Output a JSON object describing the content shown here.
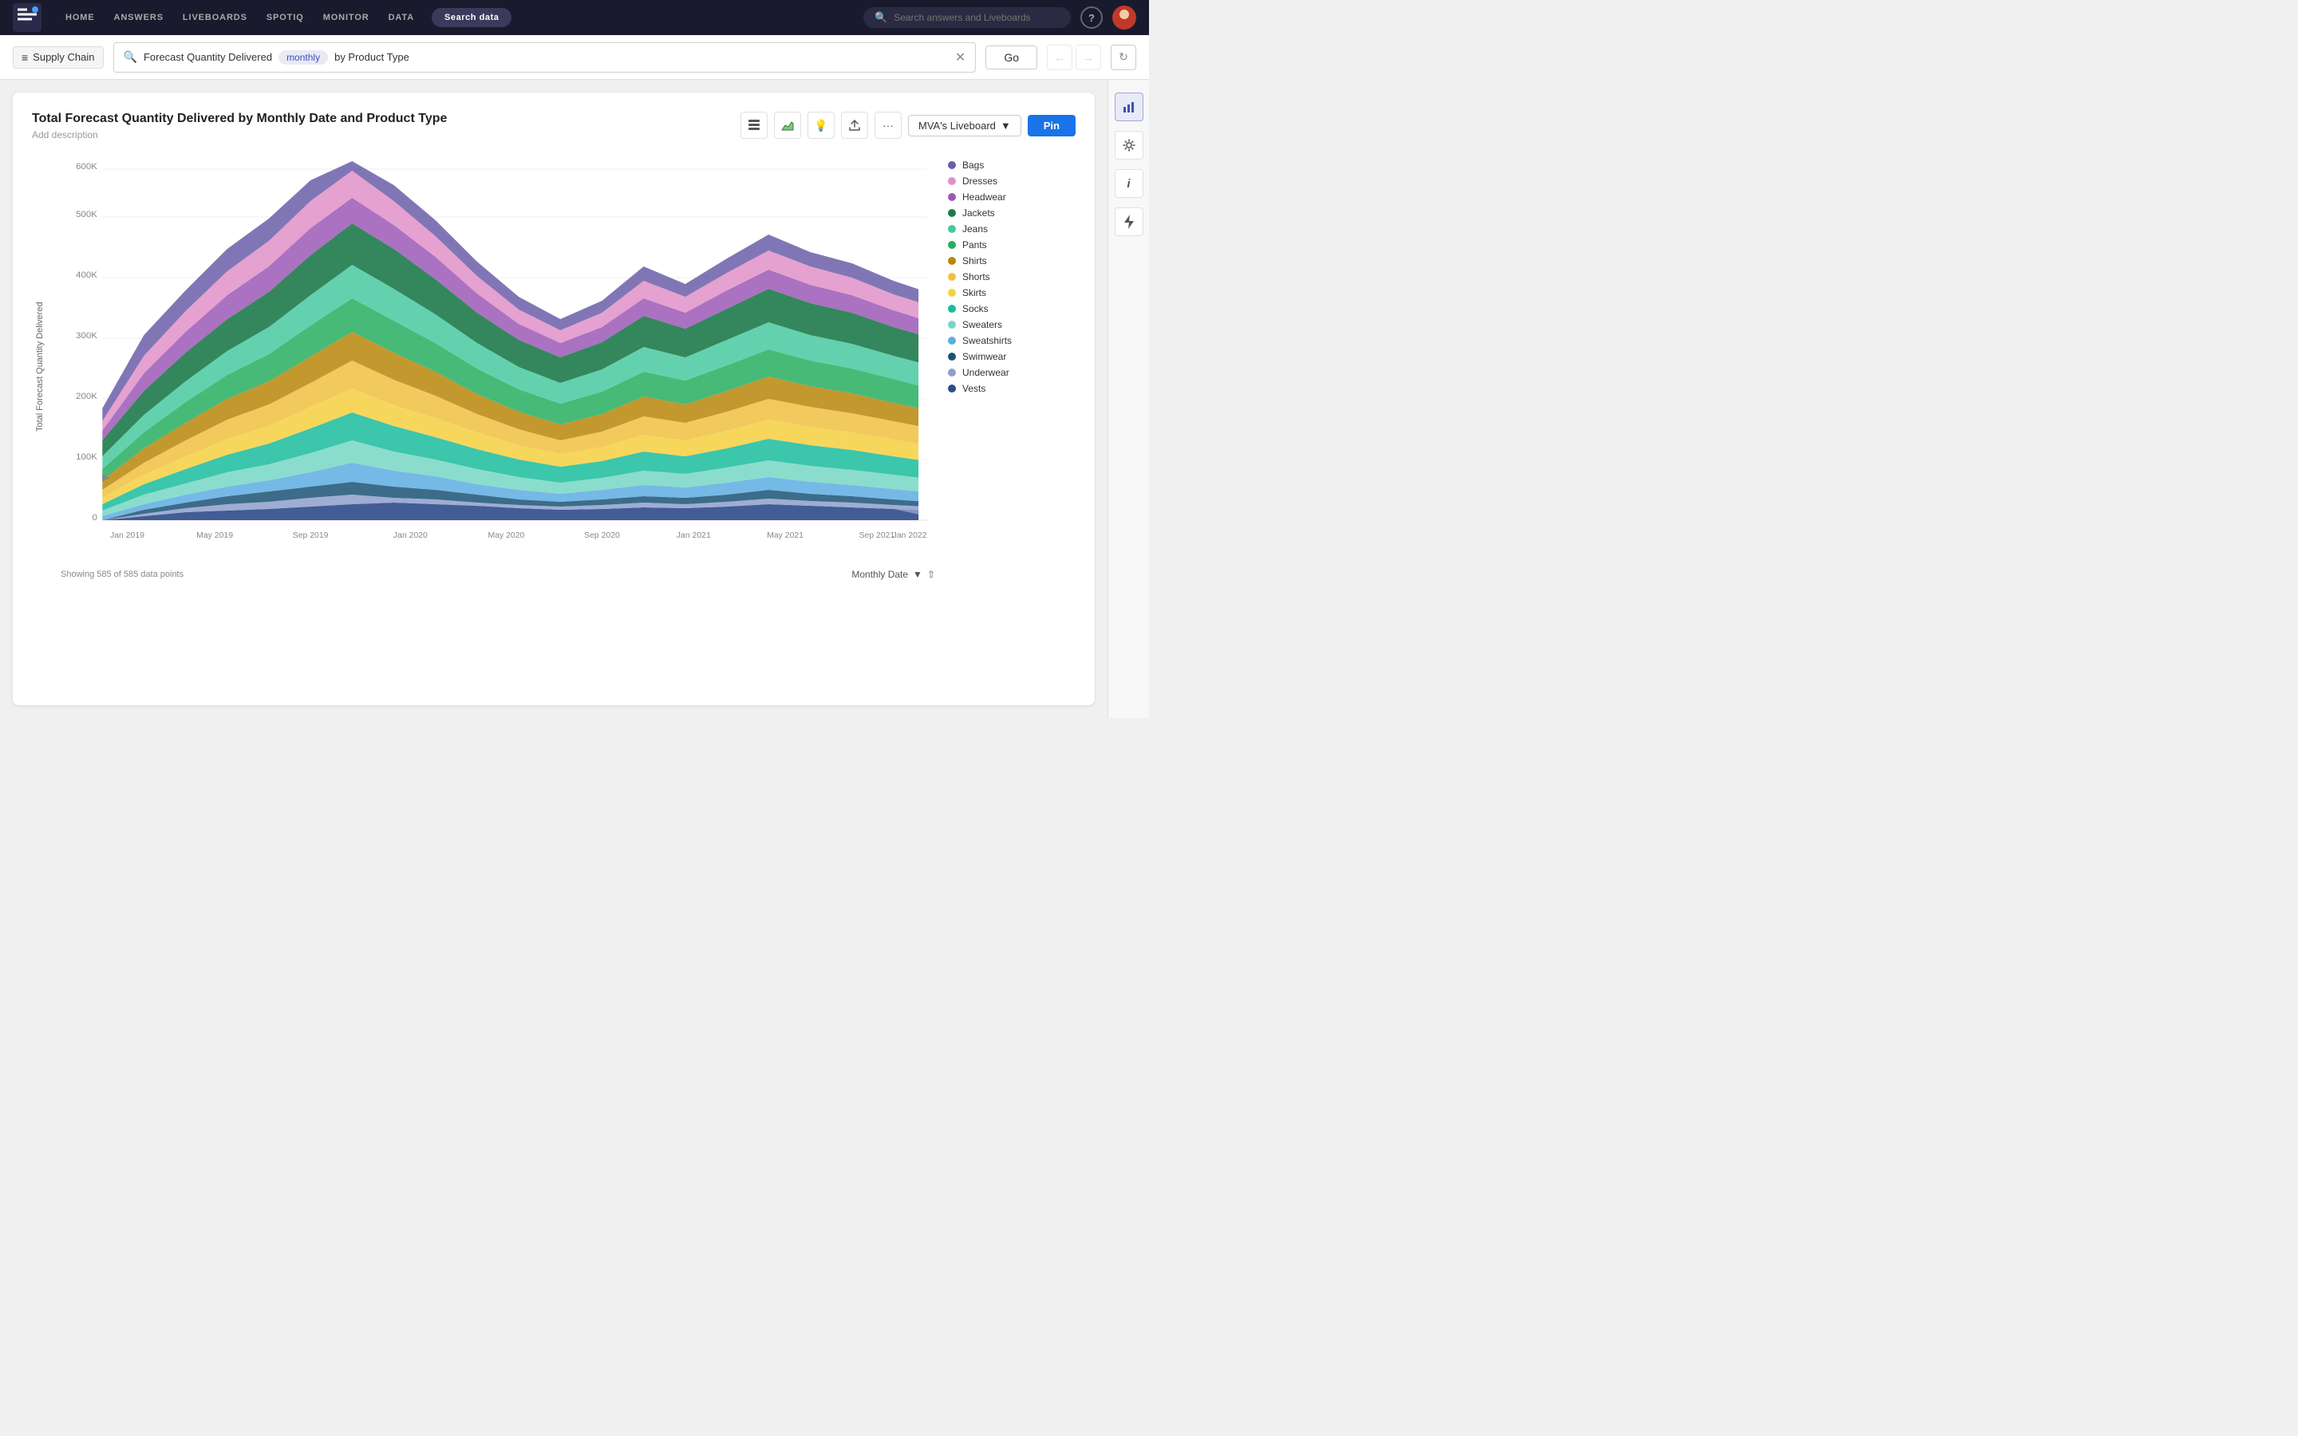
{
  "topnav": {
    "nav_items": [
      "HOME",
      "ANSWERS",
      "LIVEBOARDS",
      "SPOTIQ",
      "MONITOR",
      "DATA"
    ],
    "search_data_label": "Search data",
    "search_placeholder": "Search answers and Liveboards",
    "help_label": "?"
  },
  "searchbar": {
    "datasource": "Supply Chain",
    "query_tokens": [
      {
        "text": "Forecast Quantity Delivered",
        "type": "plain"
      },
      {
        "text": "monthly",
        "type": "pill"
      },
      {
        "text": "by Product Type",
        "type": "plain"
      }
    ],
    "go_label": "Go"
  },
  "chart": {
    "title": "Total Forecast Quantity Delivered by Monthly Date and Product Type",
    "subtitle": "Add description",
    "liveboard": "MVA's Liveboard",
    "pin_label": "Pin",
    "y_axis_label": "Total Forecast Quantity Delivered",
    "x_axis_labels": [
      "Jan 2019",
      "May 2019",
      "Sep 2019",
      "Jan 2020",
      "May 2020",
      "Sep 2020",
      "Jan 2021",
      "May 2021",
      "Sep 2021",
      "Jan 2022"
    ],
    "y_axis_ticks": [
      "0",
      "100K",
      "200K",
      "300K",
      "400K",
      "500K",
      "600K"
    ],
    "data_points_label": "Showing 585 of 585 data points",
    "sort_label": "Monthly Date",
    "legend_items": [
      {
        "name": "Bags",
        "color": "#6b5ea8"
      },
      {
        "name": "Dresses",
        "color": "#e091c8"
      },
      {
        "name": "Headwear",
        "color": "#9b59b6"
      },
      {
        "name": "Jackets",
        "color": "#1e7a4a"
      },
      {
        "name": "Jeans",
        "color": "#48c9a0"
      },
      {
        "name": "Pants",
        "color": "#27ae60"
      },
      {
        "name": "Shirts",
        "color": "#b8860b"
      },
      {
        "name": "Shorts",
        "color": "#f0c040"
      },
      {
        "name": "Skirts",
        "color": "#f5d040"
      },
      {
        "name": "Socks",
        "color": "#1abc9c"
      },
      {
        "name": "Sweaters",
        "color": "#76d7c4"
      },
      {
        "name": "Sweatshirts",
        "color": "#5dade2"
      },
      {
        "name": "Swimwear",
        "color": "#1a5276"
      },
      {
        "name": "Underwear",
        "color": "#8e9fcb"
      },
      {
        "name": "Vests",
        "color": "#2e4a8b"
      }
    ]
  },
  "right_sidebar": {
    "icons": [
      "bar-chart-icon",
      "gear-icon",
      "info-icon",
      "lightning-icon"
    ]
  }
}
